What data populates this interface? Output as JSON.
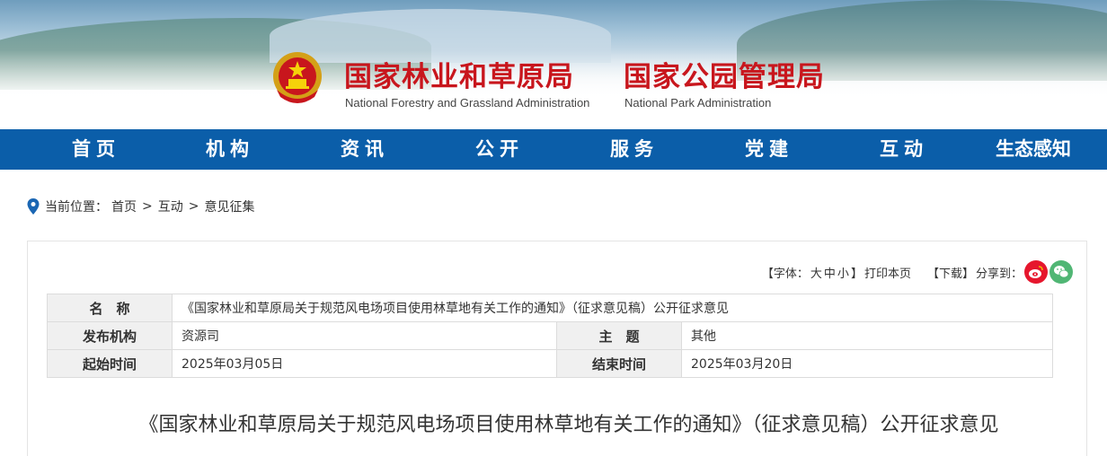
{
  "header": {
    "title_cn_1": "国家林业和草原局",
    "title_cn_2": "国家公园管理局",
    "title_en_1": "National Forestry and Grassland Administration",
    "title_en_2": "National Park Administration",
    "emblem_icon": "national-emblem-icon",
    "brand_red": "#c8161d"
  },
  "nav": {
    "bg_color": "#0b5ea9",
    "items": [
      "首页",
      "机构",
      "资讯",
      "公开",
      "服务",
      "党建",
      "互动",
      "生态感知"
    ]
  },
  "breadcrumb": {
    "prefix": "当前位置：",
    "items": [
      "首页",
      "互动",
      "意见征集"
    ],
    "separator": ">"
  },
  "toolbar": {
    "font_label_open": "【字体：",
    "font_large": "大",
    "font_medium": "中",
    "font_small": "小",
    "font_label_close": "】",
    "print": "打印本页",
    "download": "【下载】",
    "share_label": "分享到：",
    "share_icons": [
      "weibo-icon",
      "wechat-icon"
    ]
  },
  "info": {
    "name_label": "名　称",
    "name_value": "《国家林业和草原局关于规范风电场项目使用林草地有关工作的通知》（征求意见稿）公开征求意见",
    "org_label": "发布机构",
    "org_value": "资源司",
    "topic_label": "主　题",
    "topic_value": "其他",
    "start_label": "起始时间",
    "start_value": "2025年03月05日",
    "end_label": "结束时间",
    "end_value": "2025年03月20日"
  },
  "document": {
    "title": "《国家林业和草原局关于规范风电场项目使用林草地有关工作的通知》（征求意见稿）公开征求意见"
  }
}
